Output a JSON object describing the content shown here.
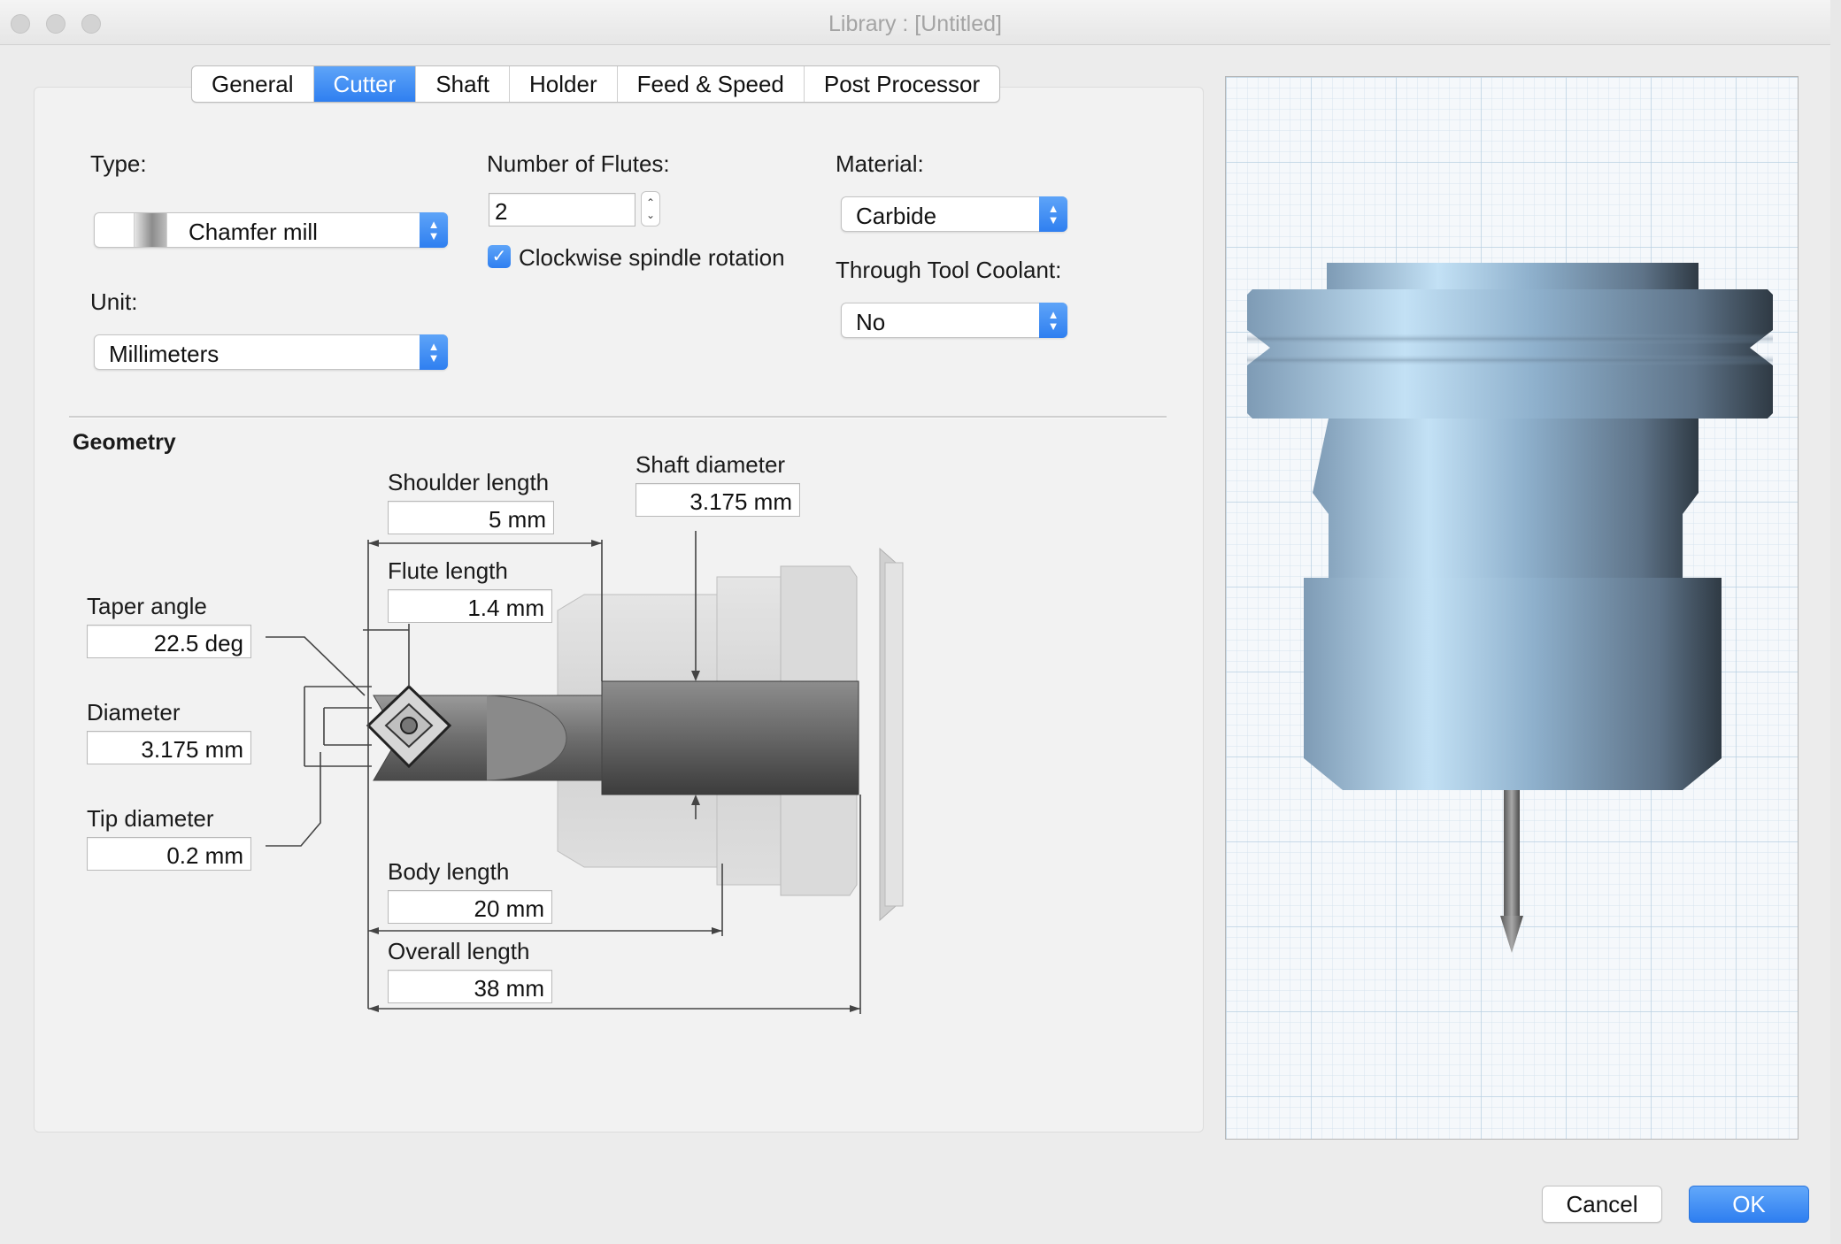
{
  "window": {
    "title": "Library : [Untitled]"
  },
  "tabs": [
    {
      "label": "General",
      "active": false
    },
    {
      "label": "Cutter",
      "active": true
    },
    {
      "label": "Shaft",
      "active": false
    },
    {
      "label": "Holder",
      "active": false
    },
    {
      "label": "Feed & Speed",
      "active": false
    },
    {
      "label": "Post Processor",
      "active": false
    }
  ],
  "form": {
    "type_label": "Type:",
    "type_value": "Chamfer mill",
    "unit_label": "Unit:",
    "unit_value": "Millimeters",
    "flutes_label": "Number of Flutes:",
    "flutes_value": "2",
    "spindle_label": "Clockwise spindle rotation",
    "spindle_checked": true,
    "material_label": "Material:",
    "material_value": "Carbide",
    "coolant_label": "Through Tool Coolant:",
    "coolant_value": "No"
  },
  "geometry": {
    "title": "Geometry",
    "shoulder_length_label": "Shoulder length",
    "shoulder_length": "5 mm",
    "shaft_diameter_label": "Shaft diameter",
    "shaft_diameter": "3.175 mm",
    "flute_length_label": "Flute length",
    "flute_length": "1.4 mm",
    "taper_angle_label": "Taper angle",
    "taper_angle": "22.5 deg",
    "diameter_label": "Diameter",
    "diameter": "3.175 mm",
    "tip_diameter_label": "Tip diameter",
    "tip_diameter": "0.2 mm",
    "body_length_label": "Body length",
    "body_length": "20 mm",
    "overall_length_label": "Overall length",
    "overall_length": "38 mm"
  },
  "buttons": {
    "cancel": "Cancel",
    "ok": "OK"
  },
  "colors": {
    "accent": "#2f7ff0",
    "holder_steel": "#8fb0cc"
  }
}
